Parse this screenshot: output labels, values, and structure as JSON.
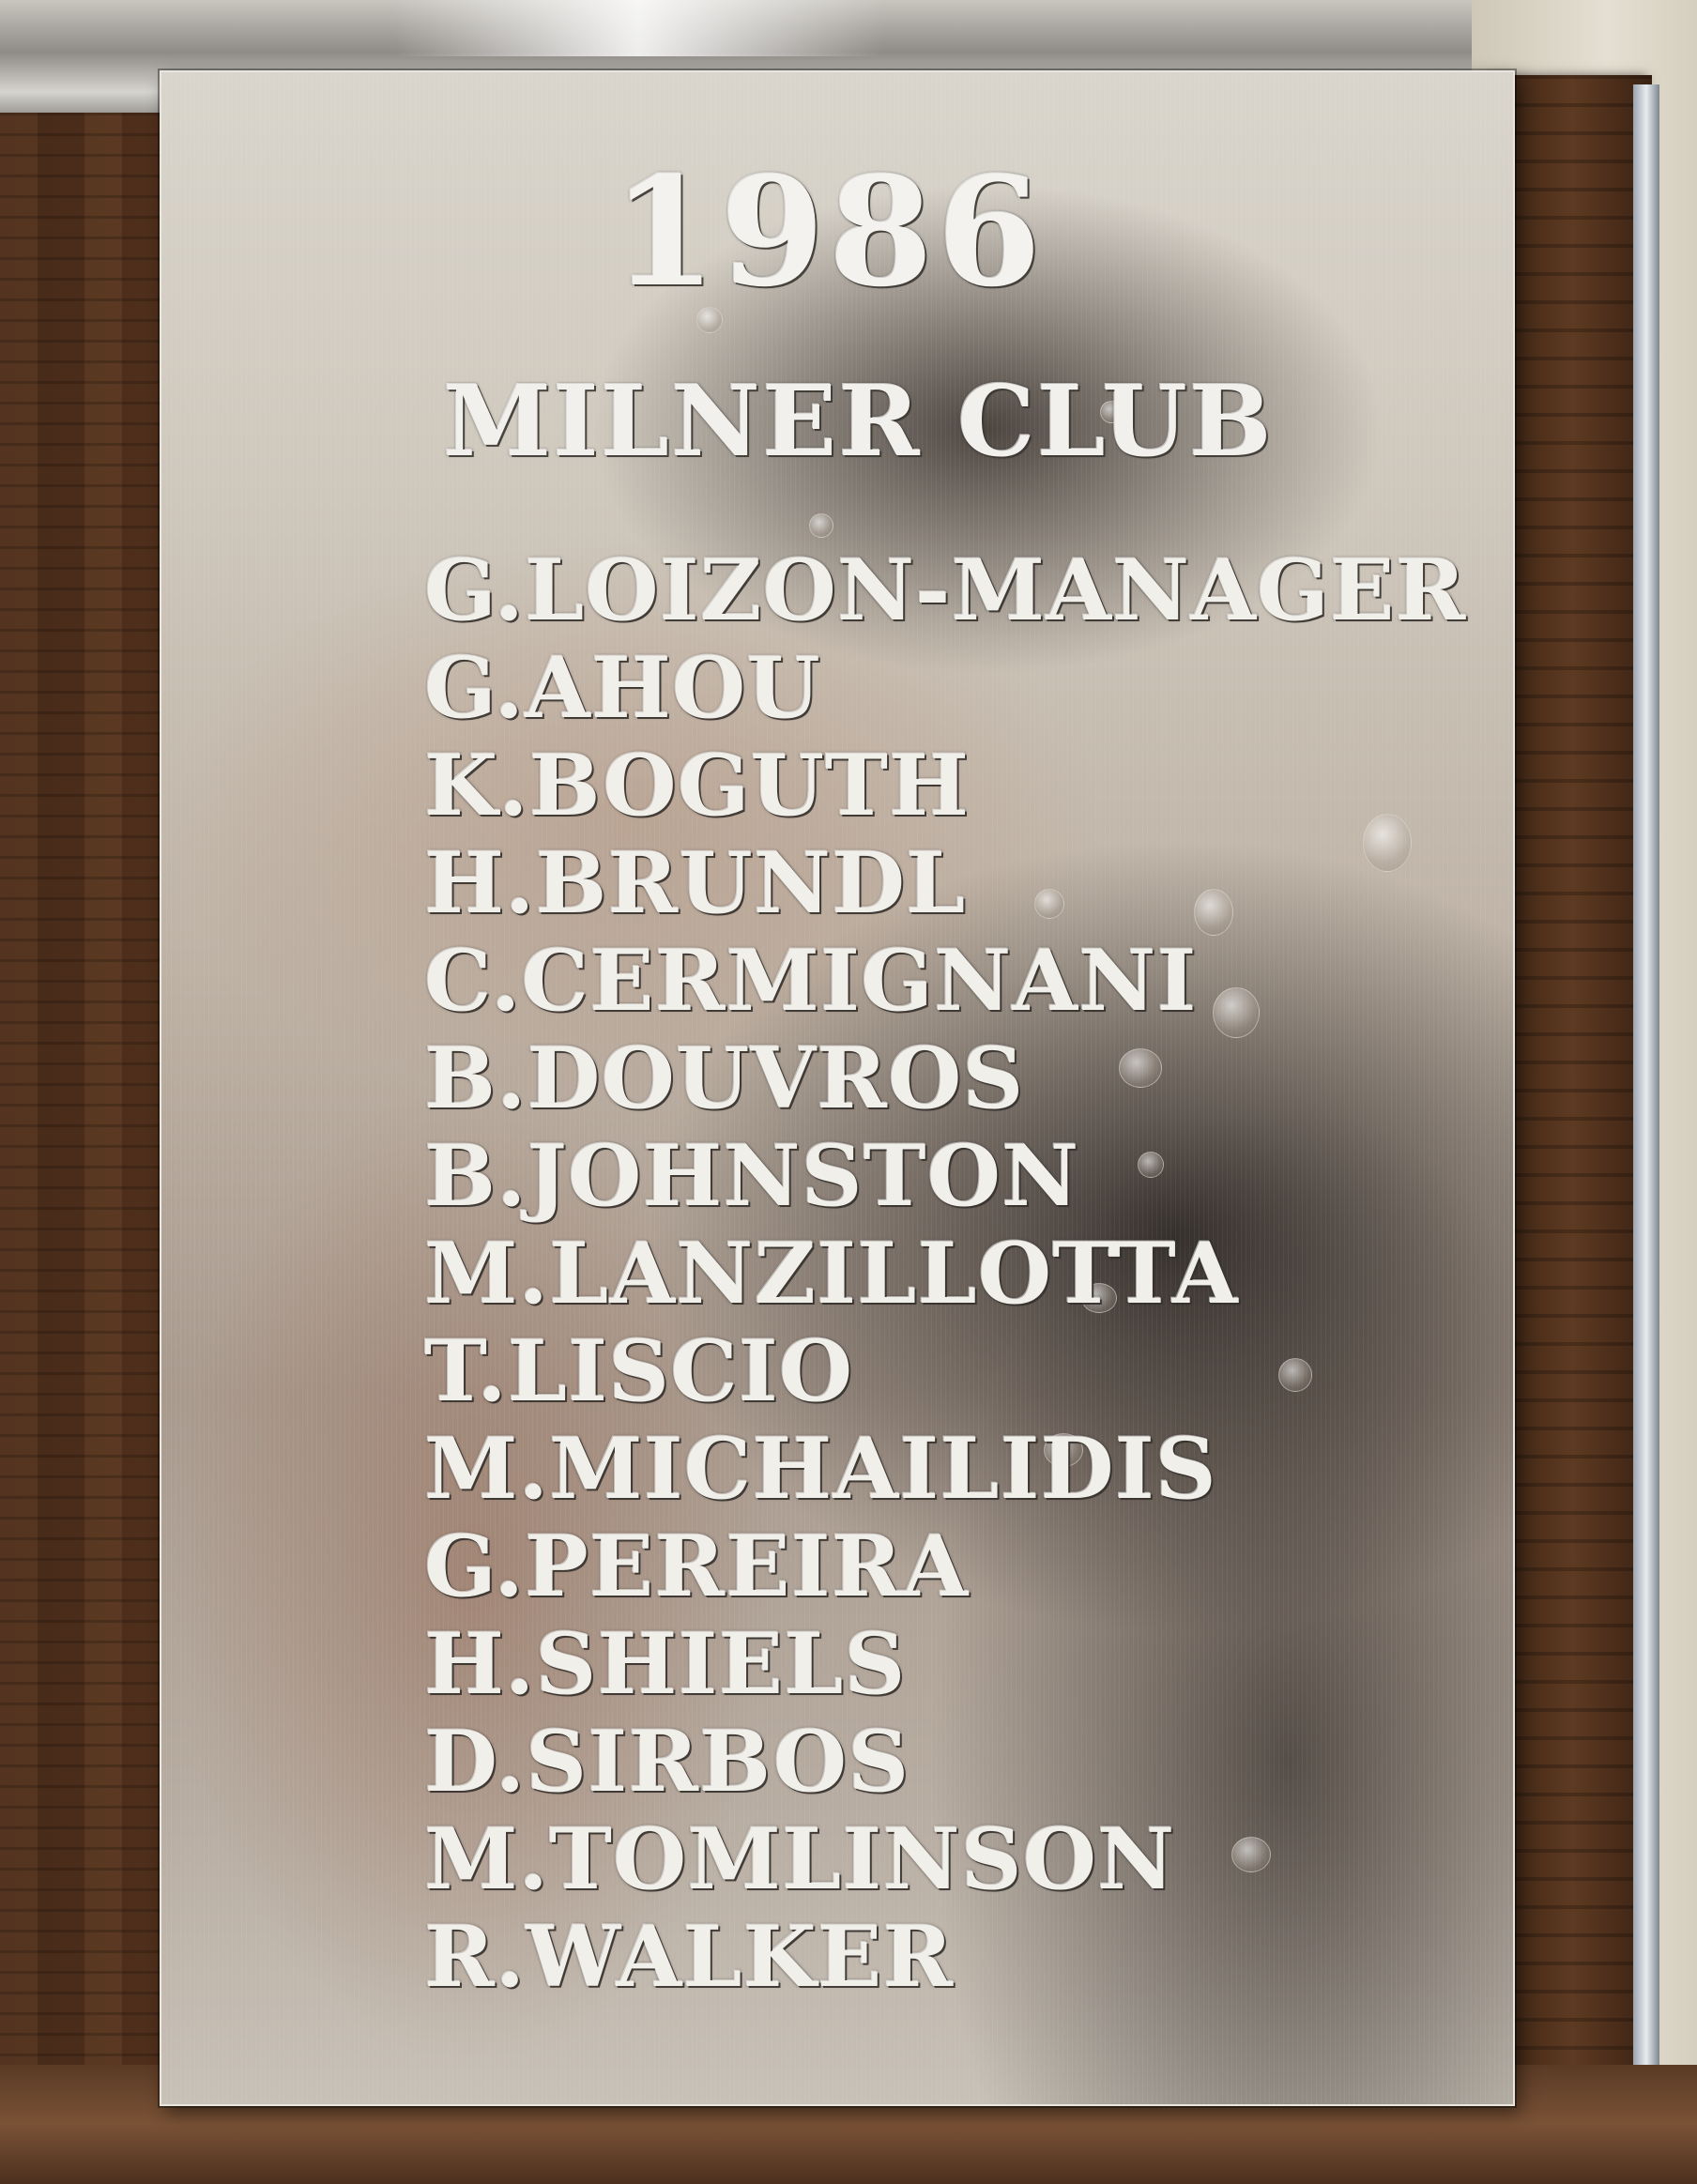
{
  "plaque": {
    "year": "1986",
    "club": "MILNER CLUB",
    "roster": [
      "G.LOIZON-MANAGER",
      "G.AHOU",
      "K.BOGUTH",
      "H.BRUNDL",
      "C.CERMIGNANI",
      "B.DOUVROS",
      "B.JOHNSTON",
      "M.LANZILLOTTA",
      "T.LISCIO",
      "M.MICHAILIDIS",
      "G.PEREIRA",
      "H.SHIELS",
      "D.SIRBOS",
      "M.TOMLINSON",
      "R.WALKER"
    ]
  },
  "colors": {
    "engraving": "#f1efea",
    "wood": "#5a3520",
    "silver": "#cfc8bd"
  }
}
